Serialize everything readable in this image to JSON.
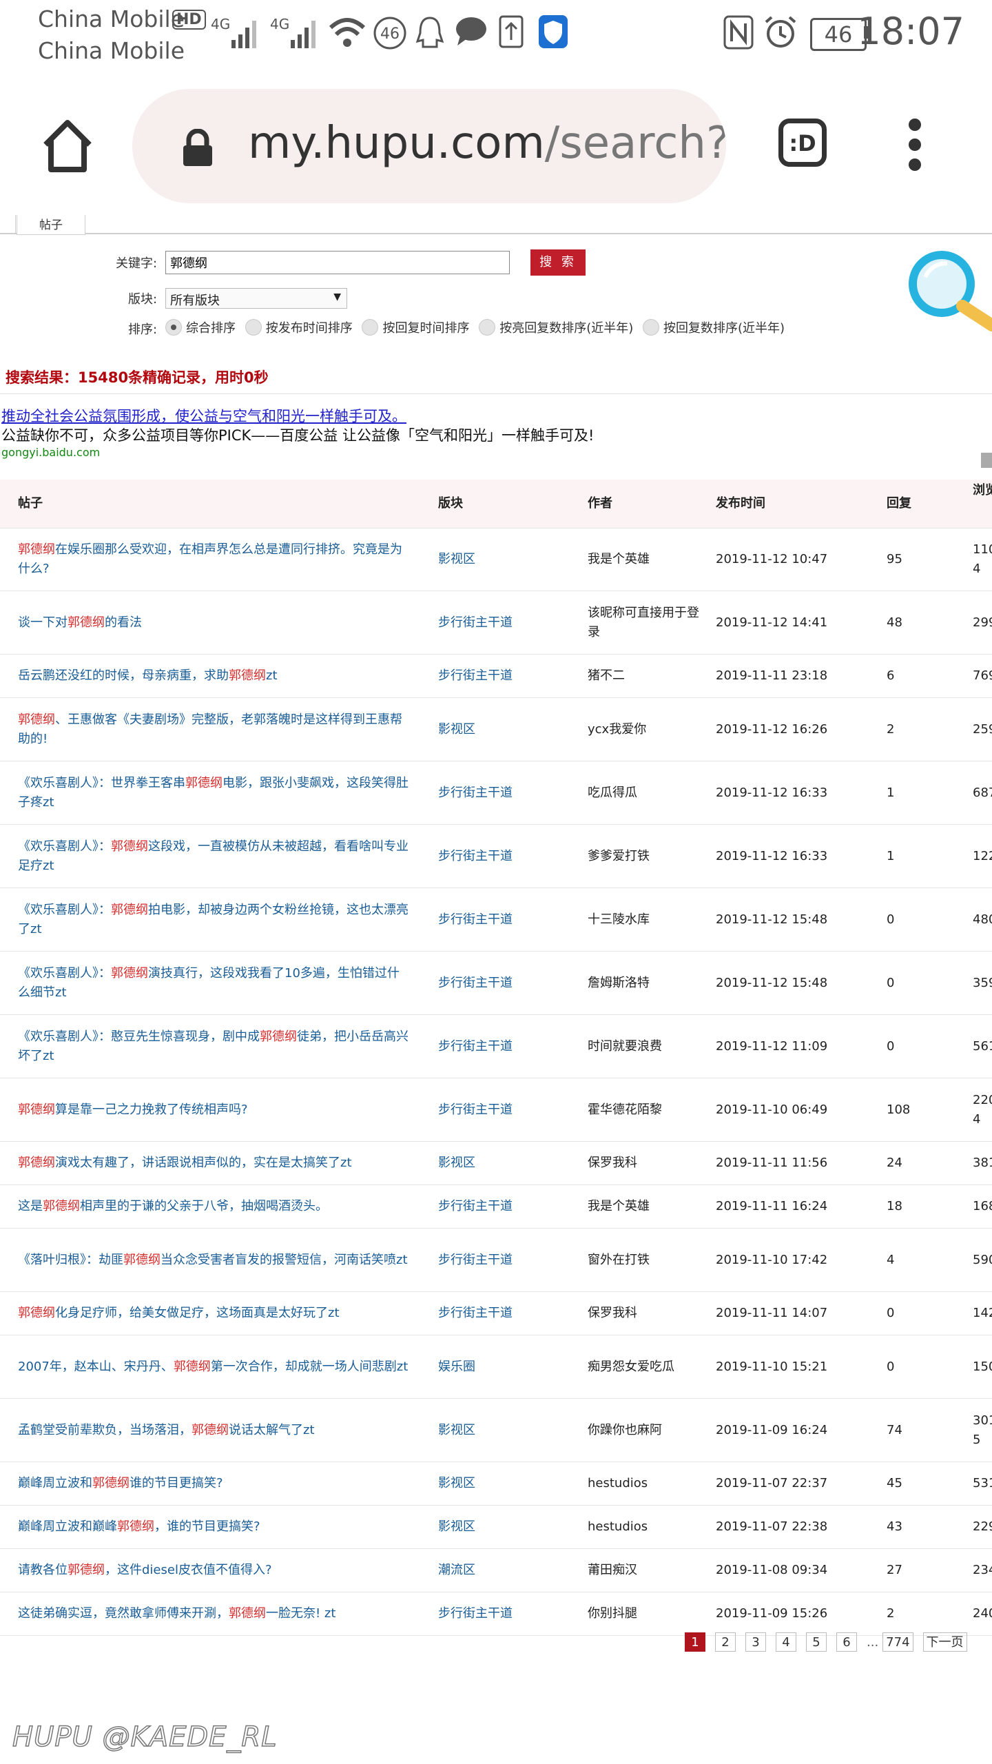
{
  "status_bar": {
    "carrier1": "China Mobile",
    "hd_badge": "HD",
    "carrier2": "China Mobile",
    "net1": "4G",
    "net2": "4G",
    "data_badge": "46",
    "battery": "46",
    "time": "18:07"
  },
  "browser": {
    "url_host": "my.hupu.com",
    "url_path": "/search?c",
    "tab_switcher_label": ":D"
  },
  "tab": {
    "label": "帖子"
  },
  "search_form": {
    "keyword_label": "关键字:",
    "keyword_value": "郭德纲",
    "search_button": "搜 索",
    "board_label": "版块:",
    "board_value": "所有版块",
    "sort_label": "排序:",
    "sort_options": [
      "综合排序",
      "按发布时间排序",
      "按回复时间排序",
      "按亮回复数排序(近半年)",
      "按回复数排序(近半年)"
    ]
  },
  "result_summary": "搜索结果：15480条精确记录，用时0秒",
  "ad": {
    "link_text": "推动全社会公益氛围形成，使公益与空气和阳光一样触手可及。",
    "description": "公益缺你不可，众多公益项目等你PICK——百度公益 让公益像「空气和阳光」一样触手可及!",
    "domain": "gongyi.baidu.com"
  },
  "table": {
    "headers": {
      "title": "帖子",
      "board": "版块",
      "author": "作者",
      "time": "发布时间",
      "replies": "回复",
      "views": "浏览数"
    },
    "rows": [
      {
        "pre": "",
        "hl": "郭德纲",
        "post": "在娱乐圈那么受欢迎，在相声界怎么总是遭同行排挤。究竟是为什么?",
        "board": "影视区",
        "author": "我是个英雄",
        "time": "2019-11-12 10:47",
        "replies": "95",
        "views": "1104"
      },
      {
        "pre": "谈一下对",
        "hl": "郭德纲",
        "post": "的看法",
        "board": "步行街主干道",
        "author": "该昵称可直接用于登录",
        "time": "2019-11-12 14:41",
        "replies": "48",
        "views": "299"
      },
      {
        "pre": "岳云鹏还没红的时候，母亲病重，求助",
        "hl": "郭德纲",
        "post": "zt",
        "board": "步行街主干道",
        "author": "猪不二",
        "time": "2019-11-11 23:18",
        "replies": "6",
        "views": "769"
      },
      {
        "pre": "",
        "hl": "郭德纲",
        "post": "、王惠做客《夫妻剧场》完整版，老郭落魄时是这样得到王惠帮助的!",
        "board": "影视区",
        "author": "ycx我爱你",
        "time": "2019-11-12 16:26",
        "replies": "2",
        "views": "259"
      },
      {
        "pre": "《欢乐喜剧人》：世界拳王客串",
        "hl": "郭德纲",
        "post": "电影，跟张小斐飙戏，这段笑得肚子疼zt",
        "board": "步行街主干道",
        "author": "吃瓜得瓜",
        "time": "2019-11-12 16:33",
        "replies": "1",
        "views": "687"
      },
      {
        "pre": "《欢乐喜剧人》：",
        "hl": "郭德纲",
        "post": "这段戏，一直被模仿从未被超越，看看啥叫专业足疗zt",
        "board": "步行街主干道",
        "author": "爹爹爱打铁",
        "time": "2019-11-12 16:33",
        "replies": "1",
        "views": "122"
      },
      {
        "pre": "《欢乐喜剧人》：",
        "hl": "郭德纲",
        "post": "拍电影，却被身边两个女粉丝抢镜，这也太漂亮了zt",
        "board": "步行街主干道",
        "author": "十三陵水库",
        "time": "2019-11-12 15:48",
        "replies": "0",
        "views": "480"
      },
      {
        "pre": "《欢乐喜剧人》：",
        "hl": "郭德纲",
        "post": "演技真行，这段戏我看了10多遍，生怕错过什么细节zt",
        "board": "步行街主干道",
        "author": "詹姆斯洛特",
        "time": "2019-11-12 15:48",
        "replies": "0",
        "views": "359"
      },
      {
        "pre": "《欢乐喜剧人》：憨豆先生惊喜现身，剧中成",
        "hl": "郭德纲",
        "post": "徒弟，把小岳岳高兴坏了zt",
        "board": "步行街主干道",
        "author": "时间就要浪费",
        "time": "2019-11-12 11:09",
        "replies": "0",
        "views": "561"
      },
      {
        "pre": "",
        "hl": "郭德纲",
        "post": "算是靠一己之力挽救了传统相声吗?",
        "board": "步行街主干道",
        "author": "霍华德花陌黎",
        "time": "2019-11-10 06:49",
        "replies": "108",
        "views": "2204"
      },
      {
        "pre": "",
        "hl": "郭德纲",
        "post": "演戏太有趣了，讲话跟说相声似的，实在是太搞笑了zt",
        "board": "影视区",
        "author": "保罗我科",
        "time": "2019-11-11 11:56",
        "replies": "24",
        "views": "381"
      },
      {
        "pre": "这是",
        "hl": "郭德纲",
        "post": "相声里的于谦的父亲于八爷，抽烟喝酒烫头。",
        "board": "步行街主干道",
        "author": "我是个英雄",
        "time": "2019-11-11 16:24",
        "replies": "18",
        "views": "168"
      },
      {
        "pre": "《落叶归根》：劫匪",
        "hl": "郭德纲",
        "post": "当众念受害者盲发的报警短信，河南话笑喷zt",
        "board": "步行街主干道",
        "author": "窗外在打铁",
        "time": "2019-11-10 17:42",
        "replies": "4",
        "views": "590"
      },
      {
        "pre": "",
        "hl": "郭德纲",
        "post": "化身足疗师，给美女做足疗，这场面真是太好玩了zt",
        "board": "步行街主干道",
        "author": "保罗我科",
        "time": "2019-11-11 14:07",
        "replies": "0",
        "views": "142"
      },
      {
        "pre": "2007年，赵本山、宋丹丹、",
        "hl": "郭德纲",
        "post": "第一次合作，却成就一场人间悲剧zt",
        "board": "娱乐圈",
        "author": "痴男怨女爱吃瓜",
        "time": "2019-11-10 15:21",
        "replies": "0",
        "views": "150"
      },
      {
        "pre": "孟鹤堂受前辈欺负，当场落泪，",
        "hl": "郭德纲",
        "post": "说话太解气了zt",
        "board": "影视区",
        "author": "你躁你也麻阿",
        "time": "2019-11-09 16:24",
        "replies": "74",
        "views": "3015"
      },
      {
        "pre": "巅峰周立波和",
        "hl": "郭德纲",
        "post": "谁的节目更搞笑?",
        "board": "影视区",
        "author": "hestudios",
        "time": "2019-11-07 22:37",
        "replies": "45",
        "views": "531"
      },
      {
        "pre": "巅峰周立波和巅峰",
        "hl": "郭德纲",
        "post": "，谁的节目更搞笑?",
        "board": "影视区",
        "author": "hestudios",
        "time": "2019-11-07 22:38",
        "replies": "43",
        "views": "229"
      },
      {
        "pre": "请教各位",
        "hl": "郭德纲",
        "post": "，这件diesel皮衣值不值得入?",
        "board": "潮流区",
        "author": "莆田痴汉",
        "time": "2019-11-08 09:34",
        "replies": "27",
        "views": "234"
      },
      {
        "pre": "这徒弟确实逗，竟然敢拿师傅来开涮，",
        "hl": "郭德纲",
        "post": "一脸无奈! zt",
        "board": "步行街主干道",
        "author": "你别抖腿",
        "time": "2019-11-09 15:26",
        "replies": "2",
        "views": "240"
      }
    ]
  },
  "pagination": {
    "pages": [
      "1",
      "2",
      "3",
      "4",
      "5",
      "6"
    ],
    "current": "1",
    "ellipsis": "...",
    "last": "774",
    "next": "下一页"
  },
  "watermark": "HUPU @KAEDE_RL"
}
